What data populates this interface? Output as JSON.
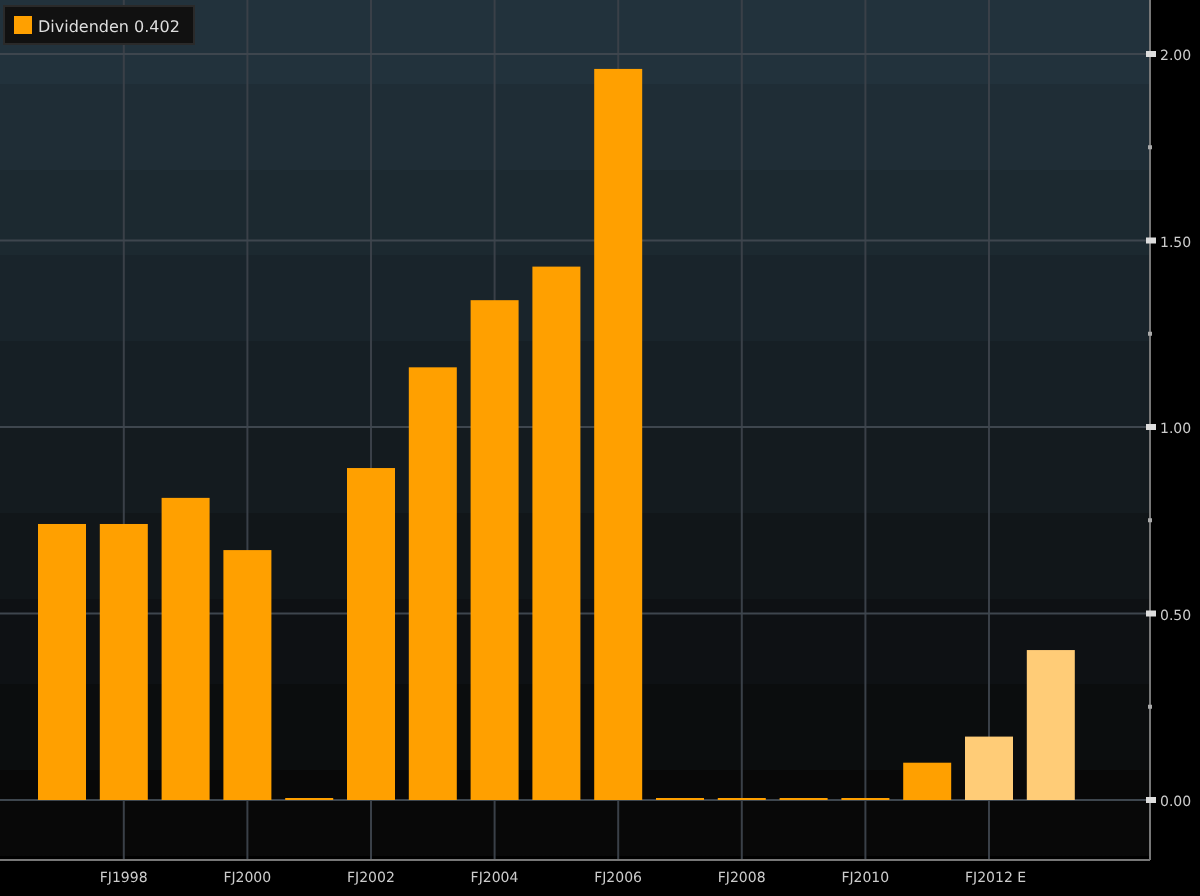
{
  "legend_reading": "0.402",
  "chart_data": {
    "type": "bar",
    "grid": true,
    "categories": [
      null,
      "FJ1998",
      null,
      "FJ2000",
      null,
      "FJ2002",
      null,
      "FJ2004",
      null,
      "FJ2006",
      null,
      "FJ2008",
      null,
      "FJ2010",
      null,
      "FJ2012 E",
      null
    ],
    "series": [
      {
        "name": "Dividenden",
        "color": "#ffa000",
        "values": [
          0.74,
          0.74,
          0.81,
          0.67,
          0,
          0.89,
          1.16,
          1.34,
          1.43,
          1.96,
          0,
          0,
          0,
          0,
          0.1,
          null,
          null
        ]
      },
      {
        "color": "#ffcc77",
        "values": [
          null,
          null,
          null,
          null,
          null,
          null,
          null,
          null,
          null,
          null,
          null,
          null,
          null,
          null,
          null,
          0.17,
          0.402
        ]
      }
    ],
    "ylim": [
      -0.15,
      2.15
    ],
    "yticks": [
      {
        "value": 0,
        "label": "0.00"
      },
      {
        "value": 0.5,
        "label": "0.50"
      },
      {
        "value": 1,
        "label": "1.00"
      },
      {
        "value": 1.5,
        "label": "1.50"
      },
      {
        "value": 2,
        "label": "2.00"
      }
    ]
  }
}
